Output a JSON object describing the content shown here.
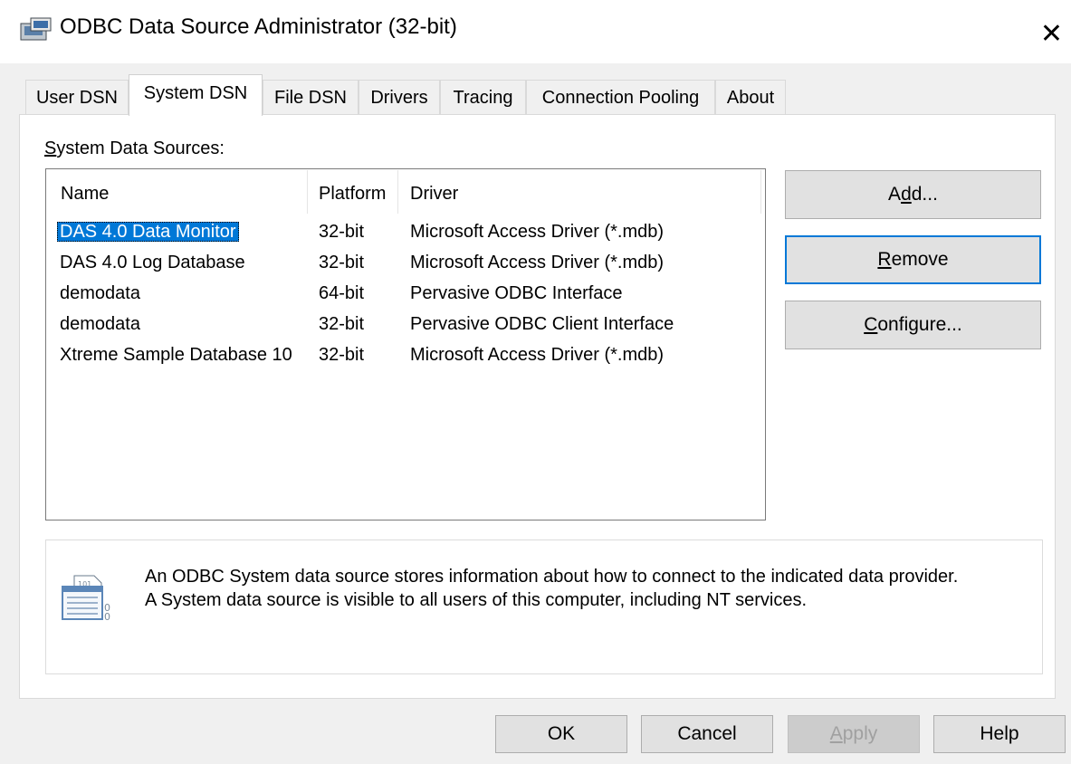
{
  "window": {
    "title": "ODBC Data Source Administrator (32-bit)"
  },
  "tabs": [
    {
      "label": "User DSN"
    },
    {
      "label": "System DSN"
    },
    {
      "label": "File DSN"
    },
    {
      "label": "Drivers"
    },
    {
      "label": "Tracing"
    },
    {
      "label": "Connection Pooling"
    },
    {
      "label": "About"
    }
  ],
  "active_tab": "System DSN",
  "section_label": {
    "mnemonic": "S",
    "rest": "ystem Data Sources:"
  },
  "columns": {
    "name": "Name",
    "platform": "Platform",
    "driver": "Driver"
  },
  "rows": [
    {
      "name": "DAS 4.0 Data Monitor",
      "platform": "32-bit",
      "driver": "Microsoft Access Driver (*.mdb)",
      "selected": true
    },
    {
      "name": "DAS 4.0 Log Database",
      "platform": "32-bit",
      "driver": "Microsoft Access Driver (*.mdb)",
      "selected": false
    },
    {
      "name": "demodata",
      "platform": "64-bit",
      "driver": "Pervasive ODBC Interface",
      "selected": false
    },
    {
      "name": "demodata",
      "platform": "32-bit",
      "driver": "Pervasive ODBC Client Interface",
      "selected": false
    },
    {
      "name": "Xtreme Sample Database 10",
      "platform": "32-bit",
      "driver": "Microsoft Access Driver (*.mdb)",
      "selected": false
    }
  ],
  "side_buttons": {
    "add": {
      "pre": "A",
      "mnemonic": "d",
      "post": "d..."
    },
    "remove": {
      "pre": "",
      "mnemonic": "R",
      "post": "emove"
    },
    "configure": {
      "pre": "",
      "mnemonic": "C",
      "post": "onfigure..."
    }
  },
  "description": {
    "line1": "An ODBC System data source stores information about how to connect to the indicated data provider.",
    "line2": "A System data source is visible to all users of this computer, including NT services."
  },
  "bottom_buttons": {
    "ok": "OK",
    "cancel": "Cancel",
    "apply": {
      "mnemonic": "A",
      "post": "pply",
      "disabled": true
    },
    "help": "Help"
  },
  "colors": {
    "accent": "#0078d7",
    "selection": "#0078d7"
  }
}
